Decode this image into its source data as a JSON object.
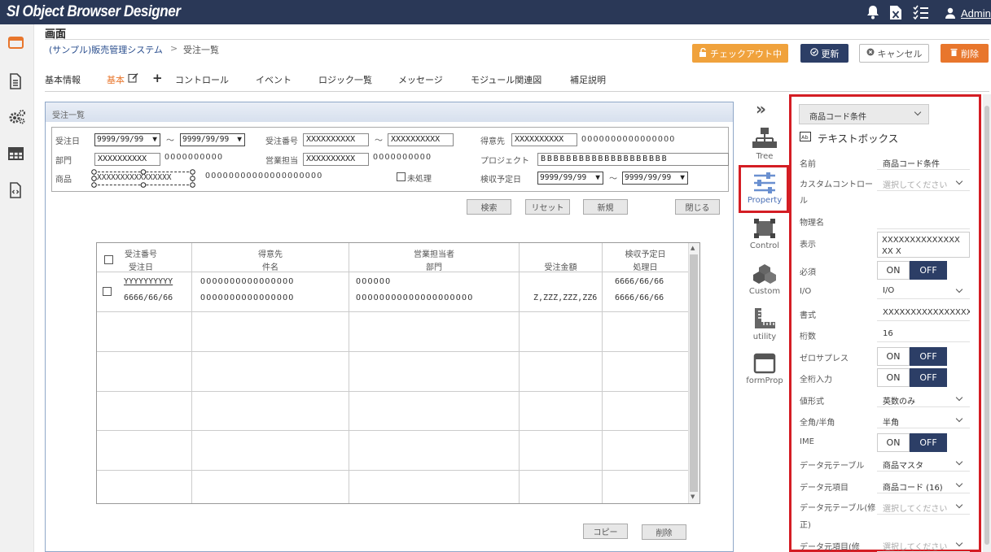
{
  "app": {
    "title": "SI Object Browser Designer",
    "user": "Admin"
  },
  "icons": {
    "bell": "bell-icon",
    "excel": "excel-icon",
    "tasks": "checklist-icon",
    "user": "user-icon"
  },
  "page": {
    "title": "画面",
    "breadcrumb_root": "(サンプル)販売管理システム",
    "breadcrumb_sep": ">",
    "breadcrumb_current": "受注一覧"
  },
  "buttons": {
    "checkout": "チェックアウト中",
    "update": "更新",
    "cancel": "キャンセル",
    "delete": "削除"
  },
  "tabs": [
    "基本情報",
    "基本",
    "コントロール",
    "イベント",
    "ロジック一覧",
    "メッセージ",
    "モジュール関連図",
    "補足説明"
  ],
  "tab_plus": "+",
  "colors": {
    "header": "#2a3857",
    "accent": "#e8762c",
    "checkout": "#f0a23c",
    "highlight": "#d41d24"
  },
  "form": {
    "title": "受注一覧",
    "search": {
      "order_date_label": "受注日",
      "date_from": "9999/99/99",
      "tilde": "〜",
      "date_to": "9999/99/99",
      "order_no_label": "受注番号",
      "order_no_from": "XXXXXXXXXX",
      "order_no_to": "XXXXXXXXXX",
      "customer_label": "得意先",
      "customer_code": "XXXXXXXXXX",
      "customer_name": "OOOOOOOOOOOOOOOO",
      "dept_label": "部門",
      "dept_code": "XXXXXXXXXX",
      "dept_name": "OOOOOOOOOO",
      "sales_label": "営業担当",
      "sales_code": "XXXXXXXXXX",
      "sales_name": "OOOOOOOOOO",
      "project_label": "プロジェクト",
      "project_value": "BBBBBBBBBBBBBBBBBBBB",
      "product_label": "商品",
      "product_code": "XXXXXXXXXXXXXXXX",
      "product_name": "OOOOOOOOOOOOOOOOOOOO",
      "unprocessed_label": "未処理",
      "due_label": "検収予定日",
      "due_from": "9999/99/99",
      "due_to": "9999/99/99"
    },
    "actions": {
      "search": "検索",
      "reset": "リセット",
      "new": "新規",
      "close": "閉じる"
    },
    "grid": {
      "headers": [
        [
          "受注番号",
          "受注日"
        ],
        [
          "得意先",
          "件名"
        ],
        [
          "営業担当者",
          "部門"
        ],
        [
          "",
          "受注金額"
        ],
        [
          "検収予定日",
          "処理日"
        ]
      ],
      "row": {
        "order_no": "YYYYYYYYYY",
        "order_date": "6666/66/66",
        "customer": "OOOOOOOOOOOOOOOO",
        "subject": "OOOOOOOOOOOOOOOO",
        "sales": "OOOOOO",
        "dept": "OOOOOOOOOOOOOOOOOOOO",
        "amount": "Z,ZZZ,ZZZ,ZZ6",
        "due": "6666/66/66",
        "processed": "6666/66/66"
      }
    },
    "bottom": {
      "copy": "コピー",
      "delete": "削除"
    }
  },
  "tools": [
    {
      "label": "Tree",
      "icon": "tree-icon"
    },
    {
      "label": "Property",
      "icon": "sliders-icon"
    },
    {
      "label": "Control",
      "icon": "control-icon"
    },
    {
      "label": "Custom",
      "icon": "cubes-icon"
    },
    {
      "label": "utility",
      "icon": "ruler-icon"
    },
    {
      "label": "formProp",
      "icon": "window-icon"
    }
  ],
  "collapse_glyph": "»",
  "panel": {
    "selector": "商品コード条件",
    "control_type": "テキストボックス",
    "props": {
      "name": {
        "label": "名前",
        "value": "商品コード条件"
      },
      "custom_control": {
        "label": "カスタムコントロール",
        "value": "選択してください"
      },
      "physical_name": {
        "label": "物理名",
        "value": ""
      },
      "display": {
        "label": "表示",
        "value": "XXXXXXXXXXXXXXXX X"
      },
      "required": {
        "label": "必須",
        "on": "ON",
        "off": "OFF"
      },
      "io": {
        "label": "I/O",
        "value": "I/O"
      },
      "format": {
        "label": "書式",
        "value": "XXXXXXXXXXXXXXXX"
      },
      "digits": {
        "label": "桁数",
        "value": "16"
      },
      "zero_suppress": {
        "label": "ゼロサプレス",
        "on": "ON",
        "off": "OFF"
      },
      "full_digits": {
        "label": "全桁入力",
        "on": "ON",
        "off": "OFF"
      },
      "value_format": {
        "label": "値形式",
        "value": "英数のみ"
      },
      "width_type": {
        "label": "全角/半角",
        "value": "半角"
      },
      "ime": {
        "label": "IME",
        "on": "ON",
        "off": "OFF"
      },
      "source_table": {
        "label": "データ元テーブル",
        "value": "商品マスタ"
      },
      "source_field": {
        "label": "データ元項目",
        "value": "商品コード (16)"
      },
      "source_table_mod": {
        "label": "データ元テーブル(修正)",
        "value": "選択してください"
      },
      "source_field_mod": {
        "label": "データ元項目(修",
        "value": "選択してください"
      }
    }
  }
}
